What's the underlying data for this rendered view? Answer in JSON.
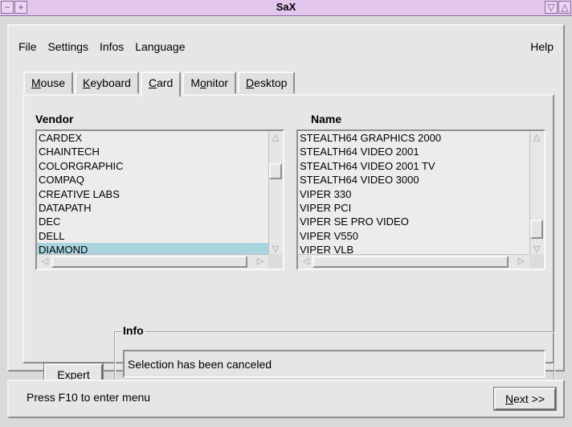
{
  "window": {
    "title": "SaX"
  },
  "menu": {
    "file": "File",
    "settings": "Settings",
    "infos": "Infos",
    "language": "Language",
    "help": "Help"
  },
  "tabs": [
    {
      "pre": "",
      "key": "M",
      "post": "ouse"
    },
    {
      "pre": "",
      "key": "K",
      "post": "eyboard"
    },
    {
      "pre": "",
      "key": "C",
      "post": "ard"
    },
    {
      "pre": "M",
      "key": "o",
      "post": "nitor"
    },
    {
      "pre": "",
      "key": "D",
      "post": "esktop"
    }
  ],
  "vendor": {
    "label": "Vendor",
    "items": [
      "CARDEX",
      "CHAINTECH",
      "COLORGRAPHIC",
      "COMPAQ",
      "CREATIVE LABS",
      "DATAPATH",
      "DEC",
      "DELL",
      "DIAMOND"
    ]
  },
  "name": {
    "label": "Name",
    "items": [
      "STEALTH64 GRAPHICS 2000",
      "STEALTH64 VIDEO 2001",
      "STEALTH64 VIDEO 2001 TV",
      "STEALTH64 VIDEO 3000",
      "VIPER 330",
      "VIPER PCI",
      "VIPER SE PRO VIDEO",
      "VIPER V550",
      "VIPER VLB"
    ]
  },
  "info": {
    "title": "Info",
    "message": "Selection has been canceled"
  },
  "expert": {
    "key": "E",
    "post": "xpert"
  },
  "status": {
    "text": "Press F10 to enter menu"
  },
  "next": {
    "key": "N",
    "post": "ext >>"
  }
}
